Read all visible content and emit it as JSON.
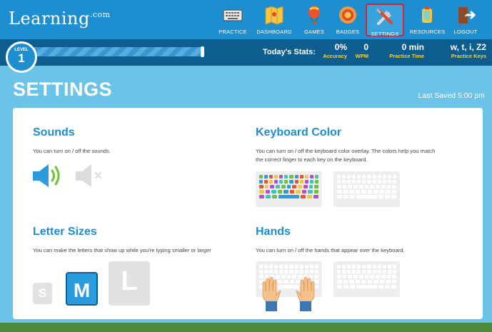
{
  "header": {
    "logo": "Learning",
    "logo_sup": ".com",
    "nav": [
      {
        "label": "PRACTICE",
        "icon": "keyboard-icon"
      },
      {
        "label": "DASHBOARD",
        "icon": "map-icon"
      },
      {
        "label": "GAMES",
        "icon": "balloon-icon"
      },
      {
        "label": "BADGES",
        "icon": "badge-icon"
      },
      {
        "label": "SETTINGS",
        "icon": "tools-icon"
      },
      {
        "label": "RESOURCES",
        "icon": "lantern-icon"
      },
      {
        "label": "LOGOUT",
        "icon": "door-icon"
      }
    ],
    "active_nav": "SETTINGS"
  },
  "levelbar": {
    "level_label": "LEVEL",
    "level": "1",
    "progress_fraction": 1.0,
    "stats_label": "Today's Stats:",
    "stats": [
      {
        "value": "0%",
        "label": "Accuracy"
      },
      {
        "value": "0",
        "label": "WPM"
      },
      {
        "value": "0 min",
        "label": "Practice Time"
      },
      {
        "value": "w, t, i, Z2",
        "label": "Practice Keys"
      }
    ]
  },
  "page": {
    "title": "SETTINGS",
    "last_saved": "Last Saved 5:00 pm"
  },
  "settings": {
    "sounds": {
      "title": "Sounds",
      "description": "You can turn on / off the sounds."
    },
    "keyboard_color": {
      "title": "Keyboard Color",
      "description_1": "You can turn on / off the keyboard color overlay. The colors help you match",
      "description_2": "the correct finger to each key on the keyboard."
    },
    "letter_sizes": {
      "title": "Letter Sizes",
      "description": "You can make the letters that show up while you're typing smaller or larger",
      "options": [
        "S",
        "M",
        "L"
      ],
      "selected": "M"
    },
    "hands": {
      "title": "Hands",
      "description": "You can turn on / off the hands that appear over the keyboard."
    }
  },
  "colors": {
    "brand_blue": "#1d8fd0",
    "dark_bar": "#0d5d8f",
    "background": "#6cc3e8",
    "accent_yellow": "#f5d33b",
    "active_border": "#d8242f"
  }
}
